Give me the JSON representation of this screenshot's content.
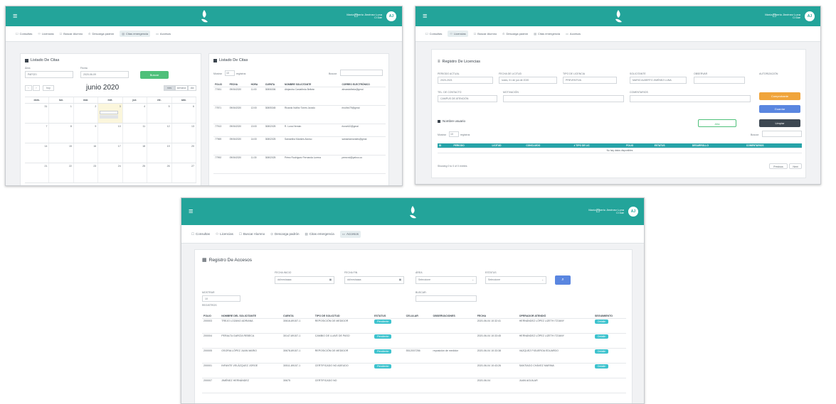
{
  "common": {
    "menu": [
      {
        "icon": "☐",
        "label": "Consultas"
      },
      {
        "icon": "⚇",
        "label": "Licencias"
      },
      {
        "icon": "☐",
        "label": "Buscar Alumno"
      },
      {
        "icon": "⊙",
        "label": "Descarga padrón"
      },
      {
        "icon": "▤",
        "label": "Citas emergencia"
      },
      {
        "icon": "▭",
        "label": "Accesos"
      }
    ],
    "user_name": "María Alberto Jiménez Luna",
    "user_role": "CI Dae",
    "avatar": "AJ",
    "colors": {
      "brand": "#23a49a",
      "tag": "#3ec3ce",
      "orange": "#f0a43a",
      "blue": "#5a86e0",
      "dark": "#3d4852"
    }
  },
  "screen1": {
    "left_title": "Listado De Citas",
    "filter_area_label": "Área",
    "filter_area_value": "PAPCEI",
    "filter_date_label": "Fecha",
    "filter_date_value": "2020-06-09",
    "search_button": "Buscar",
    "month_title": "junio 2020",
    "nav_prev": "‹",
    "nav_next": "›",
    "nav_today": "hoy",
    "view_buttons": [
      "mes",
      "semana",
      "día"
    ],
    "weekdays": [
      "dom.",
      "lun.",
      "mar.",
      "mié.",
      "jue.",
      "vie.",
      "sáb."
    ],
    "weeks": [
      [
        "31",
        "1",
        "2",
        "3",
        "4",
        "5",
        "6"
      ],
      [
        "7",
        "8",
        "9",
        "10",
        "11",
        "12",
        "13"
      ],
      [
        "14",
        "15",
        "16",
        "17",
        "18",
        "19",
        "20"
      ],
      [
        "21",
        "22",
        "23",
        "24",
        "25",
        "26",
        "27"
      ]
    ],
    "right_title": "Listado De Citas",
    "show_label": "Mostrar",
    "show_value": "10",
    "show_suffix": "registros",
    "search_label": "Buscar:",
    "columns": [
      "FOLIO",
      "FECHA",
      "HORA",
      "CUENTA",
      "NOMBRE SOLICITANTE",
      "CORREO ELECTRÓNICO"
    ],
    "rows": [
      [
        "77451",
        "09/06/2020",
        "11:00",
        "30806306",
        "Alejandra Castañeda Beltrán",
        "alecastañeda@gmai"
      ],
      [
        "77871",
        "09/06/2020",
        "12:00",
        "30805345",
        "Ricardo Núñez Torres Jurado",
        "rinuñez79@gmai"
      ],
      [
        "77913",
        "09/06/2020",
        "13:00",
        "30802025",
        "R. Luna Hernán",
        "rlunah10@gmai"
      ],
      [
        "77969",
        "09/06/2020",
        "14:00",
        "30802025",
        "Samantha Morales Alonso",
        "samantamorales@gmai"
      ],
      [
        "77992",
        "09/06/2020",
        "11:30",
        "30802025",
        "Pérez Rodríguez Fernanda Lorena",
        "perezrol@yahoo.co"
      ]
    ]
  },
  "screen2": {
    "title": "Registro De Licencias",
    "f1_label": "PERIODO ACTUAL",
    "f1_value": "2020-2021",
    "f2_label": "FECHA DE LICITUD",
    "f2_value": "lunes, 01 de jun de 2020",
    "f3_label": "TIPO DE LICENCIA",
    "f3_value": "PREVENTIVA",
    "f4_label": "SOLICITANTE",
    "f4_value": "MARIO ALBERTO JIMÉNEZ LUNA",
    "f5_label": "OBSERVAR",
    "f6_label": "AUTORIZACIÓN",
    "f7_label": "TEL. DE CONTACTO",
    "f7_value": "CAMPUS DE ATENCIÓN",
    "f8_label": "MOTIVACIÓN",
    "f9_label": "COMENTARIOS",
    "btn_orange": "Comprobante",
    "btn_blue": "Guardar",
    "btn_dark": "Limpiar",
    "btn_add": "Alta",
    "section_title": "Nombre usuario",
    "show_label": "Mostrar",
    "show_value": "10",
    "show_suffix": "registros",
    "search_label": "Buscar:",
    "columns": [
      "ID",
      "PERIODO",
      "LICITUD",
      "CONCLUIDO",
      "# TIPO DE LIC",
      "FOLIO",
      "ESTATUS",
      "DESARROLLO",
      "COMENTARIOS"
    ],
    "empty_text": "No hay datos disponibles",
    "footer_text": "Showing 0 to 0 of 0 entries",
    "prev": "Previous",
    "next": "Next"
  },
  "screen3": {
    "title": "Registro De Accesos",
    "f1_label": "FECHA INICIO",
    "f1_value": "dd/mm/aaaa",
    "f2_label": "FECHA FIN",
    "f2_value": "dd/mm/aaaa",
    "f3_label": "ÁREA",
    "f3_value": "Seleccione",
    "f4_label": "ESTATUS",
    "f4_value": "Seleccione",
    "f5_label": "MOSTRAR",
    "f5_value": "10",
    "f5_suffix": "REGISTROS",
    "f6_label": "BUSCAR:",
    "columns": [
      "FOLIO",
      "NOMBRE DEL SOLICITANTE",
      "CUENTA",
      "TIPO DE SOLICITUD",
      "ESTATUS",
      "CELULAR",
      "OBSERVACIONES",
      "FECHA",
      "OPERADOR ATENDIÓ",
      "SEGUIMIENTO"
    ],
    "rows": [
      {
        "folio": "200003",
        "name": "TREJO LOZANO ADRIANA",
        "cuenta": "30616-89157-1",
        "tipo": "REPOSICIÓN DE MEDIDOR",
        "estatus": "Pendiente",
        "celular": "",
        "obs": "",
        "fecha": "2020-06-04 10:32:41",
        "operador": "HERNÁNDEZ LÓPEZ LIZETH ITZIANY",
        "seg": "Detalle"
      },
      {
        "folio": "200004",
        "name": "PERALTA GARCÍA REBECA",
        "cuenta": "30147-89157-1",
        "tipo": "CAMBIO DE LLAVE DE PASO",
        "estatus": "Pendiente",
        "celular": "",
        "obs": "",
        "fecha": "2020-06-04 10:33:45",
        "operador": "HERNÁNDEZ LÓPEZ LIZETH ITZIANY",
        "seg": "Detalle"
      },
      {
        "folio": "200005",
        "name": "OSORIA LÓPEZ JUAN MARIO",
        "cuenta": "30678-89157-1",
        "tipo": "REPOSICIÓN DE MEDIDOR",
        "estatus": "Pendiente",
        "celular": "5512007256",
        "obs": "reposición de medidor",
        "fecha": "2020-06-04 10:33:38",
        "operador": "VAZQUEZ FIGUEROA EDUARDO",
        "seg": "Detalle"
      },
      {
        "folio": "200001",
        "name": "INFANTE VELÁZQUEZ JORGE",
        "cuenta": "30511-89157-1",
        "tipo": "CERTIFICADO NO ADEUDO",
        "estatus": "Pendiente",
        "celular": "",
        "obs": "",
        "fecha": "2020-06-04 10:43:26",
        "operador": "SANTIAGO CHÁVEZ MARINA",
        "seg": "Detalle"
      },
      {
        "folio": "200007",
        "name": "JIMÉNEZ HERNÁNDEZ",
        "cuenta": "30675",
        "tipo": "CERTIFICADO NO",
        "estatus": "",
        "celular": "",
        "obs": "",
        "fecha": "2020-06-04",
        "operador": "JUAN AGUILAR",
        "seg": ""
      }
    ]
  }
}
